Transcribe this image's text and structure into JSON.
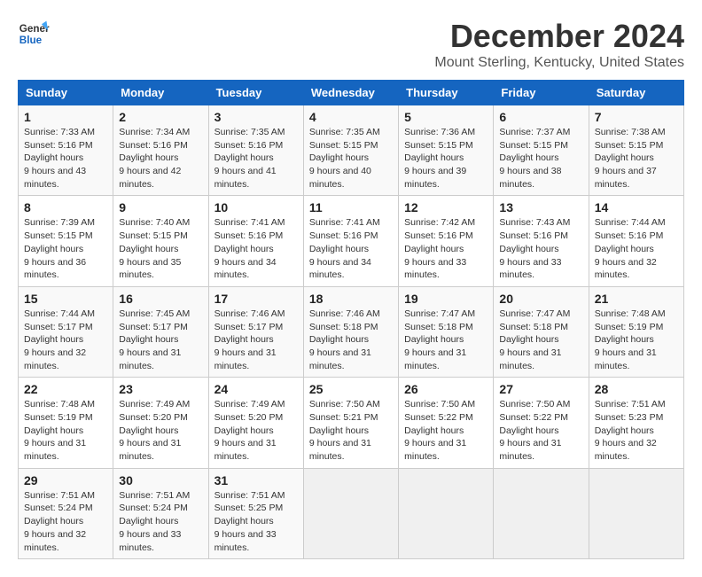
{
  "logo": {
    "line1": "General",
    "line2": "Blue"
  },
  "title": "December 2024",
  "subtitle": "Mount Sterling, Kentucky, United States",
  "weekdays": [
    "Sunday",
    "Monday",
    "Tuesday",
    "Wednesday",
    "Thursday",
    "Friday",
    "Saturday"
  ],
  "weeks": [
    [
      {
        "num": "1",
        "sunrise": "7:33 AM",
        "sunset": "5:16 PM",
        "daylight": "9 hours and 43 minutes."
      },
      {
        "num": "2",
        "sunrise": "7:34 AM",
        "sunset": "5:16 PM",
        "daylight": "9 hours and 42 minutes."
      },
      {
        "num": "3",
        "sunrise": "7:35 AM",
        "sunset": "5:16 PM",
        "daylight": "9 hours and 41 minutes."
      },
      {
        "num": "4",
        "sunrise": "7:35 AM",
        "sunset": "5:15 PM",
        "daylight": "9 hours and 40 minutes."
      },
      {
        "num": "5",
        "sunrise": "7:36 AM",
        "sunset": "5:15 PM",
        "daylight": "9 hours and 39 minutes."
      },
      {
        "num": "6",
        "sunrise": "7:37 AM",
        "sunset": "5:15 PM",
        "daylight": "9 hours and 38 minutes."
      },
      {
        "num": "7",
        "sunrise": "7:38 AM",
        "sunset": "5:15 PM",
        "daylight": "9 hours and 37 minutes."
      }
    ],
    [
      {
        "num": "8",
        "sunrise": "7:39 AM",
        "sunset": "5:15 PM",
        "daylight": "9 hours and 36 minutes."
      },
      {
        "num": "9",
        "sunrise": "7:40 AM",
        "sunset": "5:15 PM",
        "daylight": "9 hours and 35 minutes."
      },
      {
        "num": "10",
        "sunrise": "7:41 AM",
        "sunset": "5:16 PM",
        "daylight": "9 hours and 34 minutes."
      },
      {
        "num": "11",
        "sunrise": "7:41 AM",
        "sunset": "5:16 PM",
        "daylight": "9 hours and 34 minutes."
      },
      {
        "num": "12",
        "sunrise": "7:42 AM",
        "sunset": "5:16 PM",
        "daylight": "9 hours and 33 minutes."
      },
      {
        "num": "13",
        "sunrise": "7:43 AM",
        "sunset": "5:16 PM",
        "daylight": "9 hours and 33 minutes."
      },
      {
        "num": "14",
        "sunrise": "7:44 AM",
        "sunset": "5:16 PM",
        "daylight": "9 hours and 32 minutes."
      }
    ],
    [
      {
        "num": "15",
        "sunrise": "7:44 AM",
        "sunset": "5:17 PM",
        "daylight": "9 hours and 32 minutes."
      },
      {
        "num": "16",
        "sunrise": "7:45 AM",
        "sunset": "5:17 PM",
        "daylight": "9 hours and 31 minutes."
      },
      {
        "num": "17",
        "sunrise": "7:46 AM",
        "sunset": "5:17 PM",
        "daylight": "9 hours and 31 minutes."
      },
      {
        "num": "18",
        "sunrise": "7:46 AM",
        "sunset": "5:18 PM",
        "daylight": "9 hours and 31 minutes."
      },
      {
        "num": "19",
        "sunrise": "7:47 AM",
        "sunset": "5:18 PM",
        "daylight": "9 hours and 31 minutes."
      },
      {
        "num": "20",
        "sunrise": "7:47 AM",
        "sunset": "5:18 PM",
        "daylight": "9 hours and 31 minutes."
      },
      {
        "num": "21",
        "sunrise": "7:48 AM",
        "sunset": "5:19 PM",
        "daylight": "9 hours and 31 minutes."
      }
    ],
    [
      {
        "num": "22",
        "sunrise": "7:48 AM",
        "sunset": "5:19 PM",
        "daylight": "9 hours and 31 minutes."
      },
      {
        "num": "23",
        "sunrise": "7:49 AM",
        "sunset": "5:20 PM",
        "daylight": "9 hours and 31 minutes."
      },
      {
        "num": "24",
        "sunrise": "7:49 AM",
        "sunset": "5:20 PM",
        "daylight": "9 hours and 31 minutes."
      },
      {
        "num": "25",
        "sunrise": "7:50 AM",
        "sunset": "5:21 PM",
        "daylight": "9 hours and 31 minutes."
      },
      {
        "num": "26",
        "sunrise": "7:50 AM",
        "sunset": "5:22 PM",
        "daylight": "9 hours and 31 minutes."
      },
      {
        "num": "27",
        "sunrise": "7:50 AM",
        "sunset": "5:22 PM",
        "daylight": "9 hours and 31 minutes."
      },
      {
        "num": "28",
        "sunrise": "7:51 AM",
        "sunset": "5:23 PM",
        "daylight": "9 hours and 32 minutes."
      }
    ],
    [
      {
        "num": "29",
        "sunrise": "7:51 AM",
        "sunset": "5:24 PM",
        "daylight": "9 hours and 32 minutes."
      },
      {
        "num": "30",
        "sunrise": "7:51 AM",
        "sunset": "5:24 PM",
        "daylight": "9 hours and 33 minutes."
      },
      {
        "num": "31",
        "sunrise": "7:51 AM",
        "sunset": "5:25 PM",
        "daylight": "9 hours and 33 minutes."
      },
      null,
      null,
      null,
      null
    ]
  ]
}
